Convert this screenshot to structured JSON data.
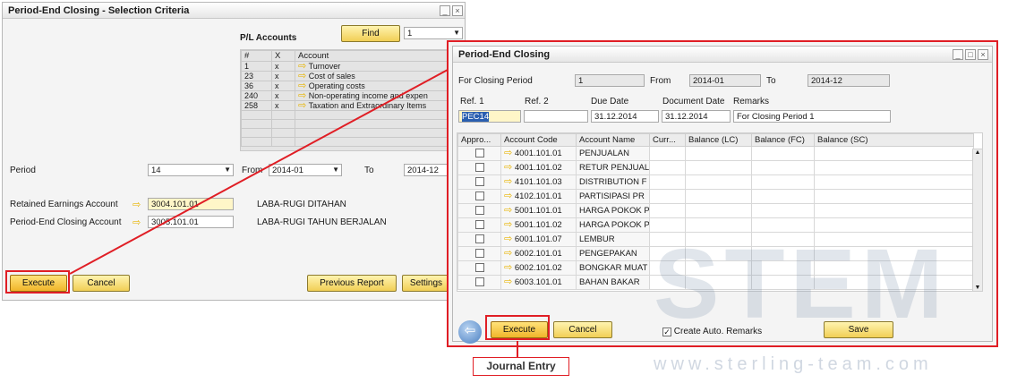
{
  "left_window": {
    "title": "Period-End Closing - Selection Criteria",
    "pl_accounts_label": "P/L Accounts",
    "find_label": "Find",
    "find_value": "1",
    "table_headers": [
      "#",
      "X",
      "Account"
    ],
    "rows": [
      {
        "num": "1",
        "x": "x",
        "account": "Turnover"
      },
      {
        "num": "23",
        "x": "x",
        "account": "Cost of sales"
      },
      {
        "num": "36",
        "x": "x",
        "account": "Operating costs"
      },
      {
        "num": "240",
        "x": "x",
        "account": "Non-operating income and expen"
      },
      {
        "num": "258",
        "x": "x",
        "account": "Taxation and Extraordinary Items"
      }
    ],
    "period_label": "Period",
    "period_value": "14",
    "from_label": "From",
    "from_value": "2014-01",
    "to_label": "To",
    "to_value": "2014-12",
    "retained_label": "Retained Earnings Account",
    "retained_value": "3004.101.01",
    "retained_name": "LABA-RUGI DITAHAN",
    "pec_label": "Period-End Closing Account",
    "pec_value": "3005.101.01",
    "pec_name": "LABA-RUGI TAHUN BERJALAN",
    "execute_label": "Execute",
    "cancel_label": "Cancel",
    "previous_report_label": "Previous Report",
    "settings_label": "Settings"
  },
  "right_window": {
    "title": "Period-End Closing",
    "for_closing_label": "For Closing Period",
    "for_closing_value": "1",
    "from_label": "From",
    "from_value": "2014-01",
    "to_label": "To",
    "to_value": "2014-12",
    "ref1_label": "Ref. 1",
    "ref1_value": "PEC14",
    "ref2_label": "Ref. 2",
    "ref2_value": "",
    "due_label": "Due Date",
    "due_value": "31.12.2014",
    "doc_label": "Document Date",
    "doc_value": "31.12.2014",
    "remarks_label": "Remarks",
    "remarks_value": "For Closing Period 1",
    "headers": [
      "Appro...",
      "Account Code",
      "Account Name",
      "Curr...",
      "Balance (LC)",
      "Balance (FC)",
      "Balance (SC)"
    ],
    "rows": [
      {
        "code": "4001.101.01",
        "name": "PENJUALAN"
      },
      {
        "code": "4001.101.02",
        "name": "RETUR PENJUALA"
      },
      {
        "code": "4101.101.03",
        "name": "DISTRIBUTION F"
      },
      {
        "code": "4102.101.01",
        "name": "PARTISIPASI PR"
      },
      {
        "code": "5001.101.01",
        "name": "HARGA POKOK P"
      },
      {
        "code": "5001.101.02",
        "name": "HARGA POKOK P"
      },
      {
        "code": "6001.101.07",
        "name": "LEMBUR"
      },
      {
        "code": "6002.101.01",
        "name": "PENGEPAKAN"
      },
      {
        "code": "6002.101.02",
        "name": "BONGKAR MUAT"
      },
      {
        "code": "6003.101.01",
        "name": "BAHAN BAKAR"
      }
    ],
    "execute_label": "Execute",
    "cancel_label": "Cancel",
    "auto_remarks_label": "Create Auto. Remarks",
    "save_label": "Save"
  },
  "callout_label": "Journal Entry",
  "watermark_text": "STEM",
  "watermark_url": "www.sterling-team.com",
  "colors": {
    "accent_red": "#e01e25",
    "button_yellow": "#f1cf55",
    "link_arrow": "#e8b400"
  }
}
